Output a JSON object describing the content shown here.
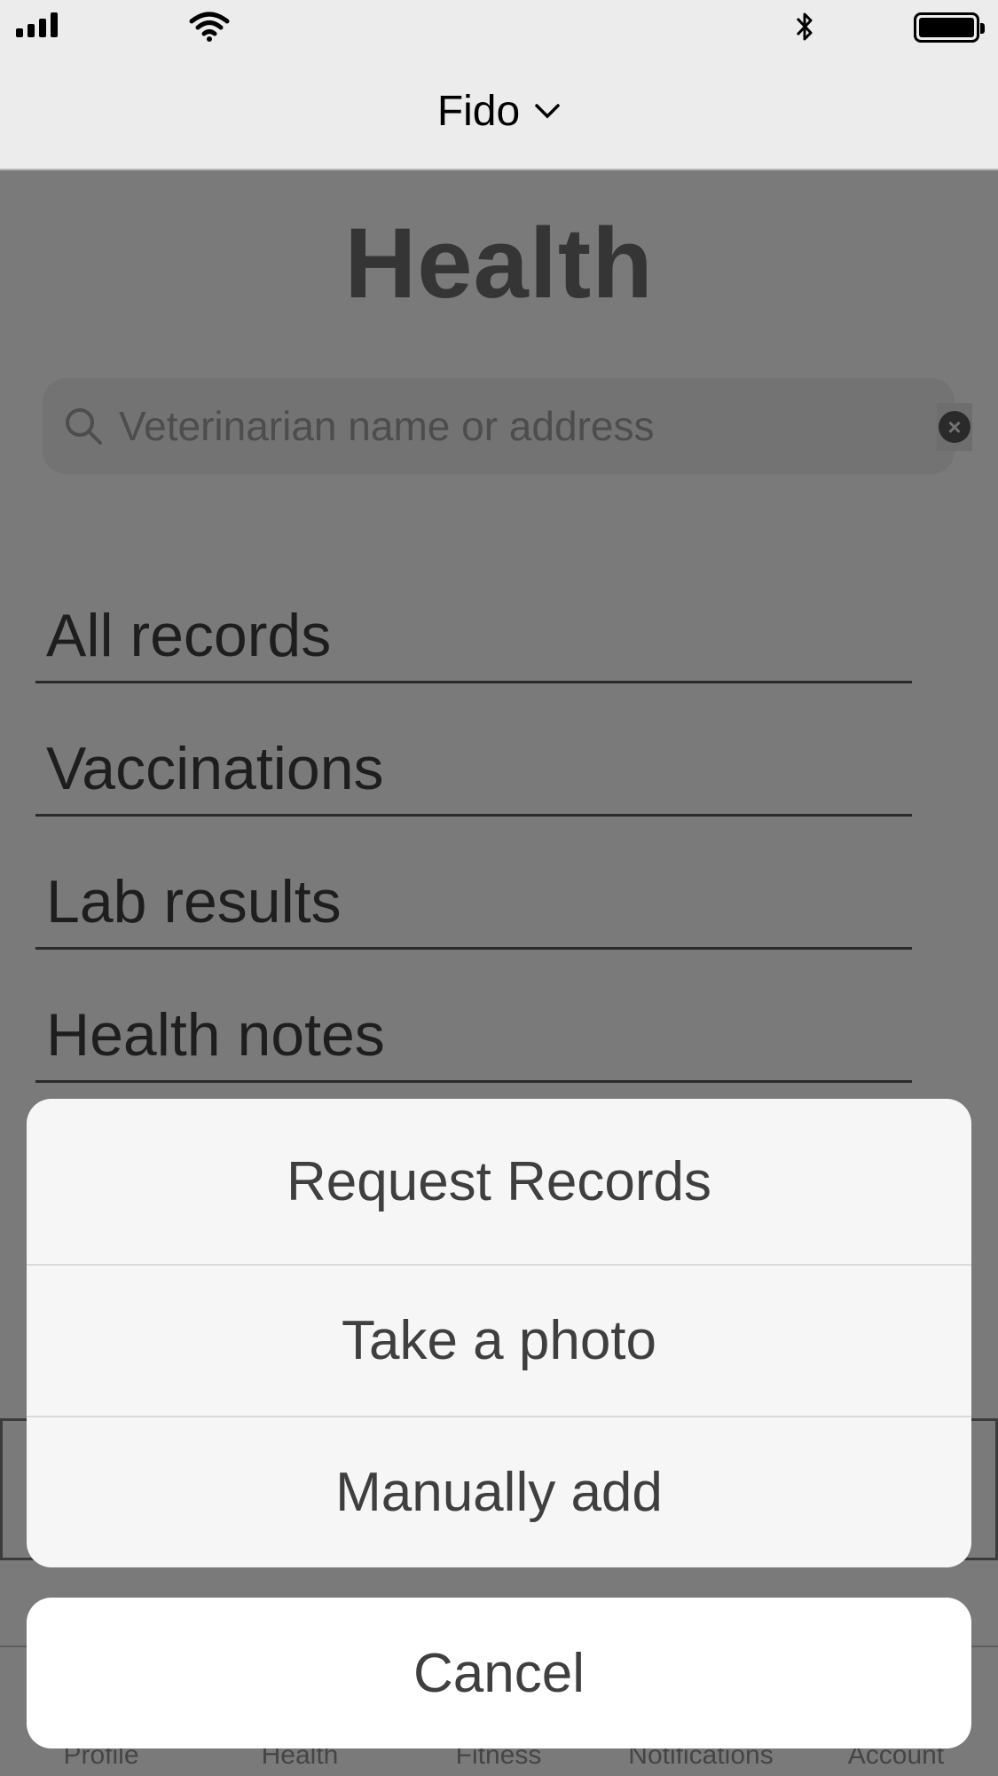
{
  "header": {
    "pet_name": "Fido"
  },
  "page": {
    "title": "Health"
  },
  "search": {
    "placeholder": "Veterinarian name or address"
  },
  "records": [
    {
      "label": "All records"
    },
    {
      "label": "Vaccinations"
    },
    {
      "label": "Lab results"
    },
    {
      "label": "Health notes"
    }
  ],
  "tabs": [
    {
      "label": "Profile"
    },
    {
      "label": "Health"
    },
    {
      "label": "Fitness"
    },
    {
      "label": "Notifications"
    },
    {
      "label": "Account"
    }
  ],
  "action_sheet": {
    "options": [
      {
        "label": "Request Records"
      },
      {
        "label": "Take a photo"
      },
      {
        "label": "Manually add"
      }
    ],
    "cancel_label": "Cancel"
  }
}
